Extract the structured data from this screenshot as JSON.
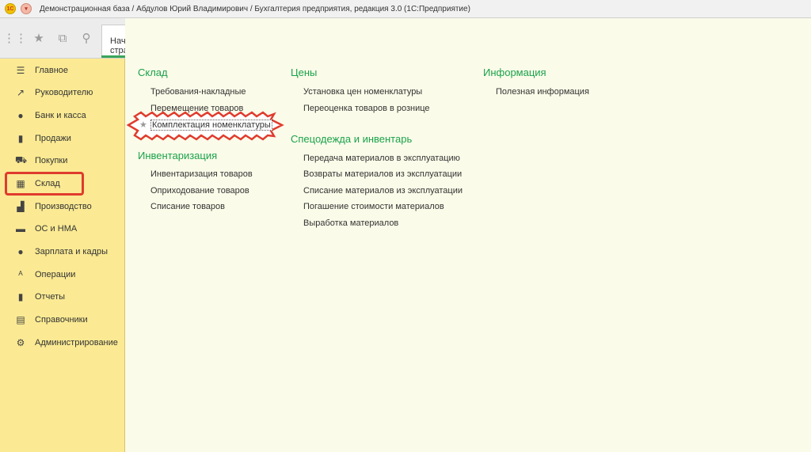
{
  "window": {
    "title": "Демонстрационная база / Абдулов Юрий Владимирович / Бухгалтерия предприятия, редакция 3.0  (1С:Предприятие)",
    "logo": "1С"
  },
  "toolbar": {
    "home_tab_label": "Начальная страница"
  },
  "sidebar": {
    "items": [
      {
        "label": "Главное",
        "icon": "menu-lines-icon"
      },
      {
        "label": "Руководителю",
        "icon": "trend-icon"
      },
      {
        "label": "Банк и касса",
        "icon": "ruble-icon"
      },
      {
        "label": "Продажи",
        "icon": "bag-icon"
      },
      {
        "label": "Покупки",
        "icon": "cart-icon"
      },
      {
        "label": "Склад",
        "icon": "grid-icon"
      },
      {
        "label": "Производство",
        "icon": "factory-icon"
      },
      {
        "label": "ОС и НМА",
        "icon": "truck-icon"
      },
      {
        "label": "Зарплата и кадры",
        "icon": "person-icon"
      },
      {
        "label": "Операции",
        "icon": "operations-icon"
      },
      {
        "label": "Отчеты",
        "icon": "bar-chart-icon"
      },
      {
        "label": "Справочники",
        "icon": "books-icon"
      },
      {
        "label": "Администрирование",
        "icon": "gear-icon"
      }
    ],
    "selected": "Склад"
  },
  "sections": {
    "sklad": {
      "title": "Склад",
      "links": [
        "Требования-накладные",
        "Перемещение товаров",
        "Комплектация номенклатуры"
      ]
    },
    "inventar": {
      "title": "Инвентаризация",
      "links": [
        "Инвентаризация товаров",
        "Оприходование товаров",
        "Списание товаров"
      ]
    },
    "ceny": {
      "title": "Цены",
      "links": [
        "Установка цен номенклатуры",
        "Переоценка товаров в рознице"
      ]
    },
    "specodezhda": {
      "title": "Спецодежда и инвентарь",
      "links": [
        "Передача материалов в эксплуатацию",
        "Возвраты материалов из эксплуатации",
        "Списание материалов из эксплуатации",
        "Погашение стоимости материалов",
        "Выработка материалов"
      ]
    },
    "info": {
      "title": "Информация",
      "links": [
        "Полезная информация"
      ]
    }
  },
  "colors": {
    "sidebar_bg": "#fbea93",
    "section_title": "#1aa24b",
    "highlight": "#e03b2e"
  }
}
